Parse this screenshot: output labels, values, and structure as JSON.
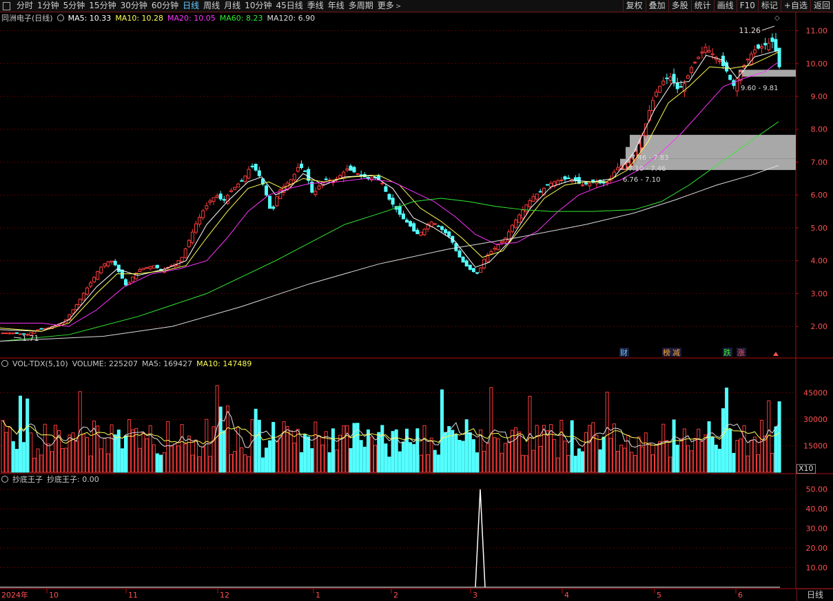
{
  "toolbar": {
    "periods": [
      "分时",
      "1分钟",
      "5分钟",
      "15分钟",
      "30分钟",
      "60分钟",
      "日线",
      "周线",
      "月线",
      "10分钟",
      "45日线",
      "季线",
      "年线",
      "多周期"
    ],
    "active_period": "日线",
    "more": "更多",
    "right_buttons": [
      "复权",
      "叠加",
      "多股",
      "统计",
      "画线",
      "F10",
      "标记",
      "+自选",
      "返回"
    ]
  },
  "main_panel": {
    "title": "同洲电子(日线)",
    "ma_labels": [
      {
        "text": "MA5: 10.33",
        "color": "#ffffff"
      },
      {
        "text": "MA10: 10.28",
        "color": "#ffff54"
      },
      {
        "text": "MA20: 10.05",
        "color": "#ff33ff"
      },
      {
        "text": "MA60: 8.23",
        "color": "#33ee33"
      },
      {
        "text": "MA120: 6.90",
        "color": "#dddddd"
      }
    ],
    "high_label": "11.26",
    "low_label": "1.71",
    "gap_labels": [
      "9.60 - 9.81",
      "7.46 - 7.83",
      "7.10 - 7.46",
      "6.76 - 7.10"
    ],
    "event_markers": [
      "财",
      "榜",
      "减",
      "跌",
      "涨"
    ]
  },
  "volume_panel": {
    "title": "VOL-TDX(5,10)",
    "volume": "VOLUME: 225207",
    "ma5": "MA5: 169427",
    "ma10": "MA10: 147489",
    "scale": "X10"
  },
  "indicator_panel": {
    "title": "抄底王子",
    "value_label": "抄底王子: 0.00"
  },
  "x_axis": {
    "year_label": "2024年",
    "month_labels": [
      "10",
      "11",
      "12",
      "1",
      "2",
      "3",
      "4",
      "5",
      "6"
    ],
    "period_label": "日线"
  },
  "chart_data": [
    {
      "type": "candlestick",
      "ylim": [
        1.3,
        11.9
      ],
      "y_ticks": [
        2.0,
        3.0,
        4.0,
        5.0,
        6.0,
        7.0,
        8.0,
        9.0,
        10.0,
        11.0
      ],
      "close_path": [
        [
          0,
          1.8
        ],
        [
          20,
          1.8
        ],
        [
          40,
          1.75
        ],
        [
          55,
          1.9
        ],
        [
          70,
          1.95
        ],
        [
          85,
          2.05
        ],
        [
          95,
          2.15
        ],
        [
          105,
          2.45
        ],
        [
          115,
          2.75
        ],
        [
          125,
          3.1
        ],
        [
          135,
          3.4
        ],
        [
          145,
          3.75
        ],
        [
          155,
          3.95
        ],
        [
          165,
          4.0
        ],
        [
          175,
          3.6
        ],
        [
          185,
          3.2
        ],
        [
          195,
          3.55
        ],
        [
          205,
          3.75
        ],
        [
          215,
          3.8
        ],
        [
          225,
          3.85
        ],
        [
          235,
          3.7
        ],
        [
          245,
          3.8
        ],
        [
          255,
          3.9
        ],
        [
          265,
          4.1
        ],
        [
          275,
          4.6
        ],
        [
          285,
          5.1
        ],
        [
          295,
          5.5
        ],
        [
          305,
          5.8
        ],
        [
          315,
          6.0
        ],
        [
          325,
          5.8
        ],
        [
          335,
          6.1
        ],
        [
          345,
          6.3
        ],
        [
          355,
          6.5
        ],
        [
          365,
          6.9
        ],
        [
          375,
          6.7
        ],
        [
          385,
          6.2
        ],
        [
          395,
          5.4
        ],
        [
          405,
          6.1
        ],
        [
          415,
          6.3
        ],
        [
          425,
          6.5
        ],
        [
          435,
          6.9
        ],
        [
          445,
          6.7
        ],
        [
          455,
          6.0
        ],
        [
          465,
          6.3
        ],
        [
          475,
          6.5
        ],
        [
          485,
          6.4
        ],
        [
          495,
          6.6
        ],
        [
          505,
          6.8
        ],
        [
          515,
          6.7
        ],
        [
          525,
          6.6
        ],
        [
          535,
          6.5
        ],
        [
          545,
          6.55
        ],
        [
          555,
          6.4
        ],
        [
          565,
          5.9
        ],
        [
          575,
          5.6
        ],
        [
          585,
          5.3
        ],
        [
          595,
          5.1
        ],
        [
          605,
          4.8
        ],
        [
          615,
          4.9
        ],
        [
          625,
          5.2
        ],
        [
          635,
          5.1
        ],
        [
          645,
          4.9
        ],
        [
          655,
          4.7
        ],
        [
          665,
          4.2
        ],
        [
          675,
          3.9
        ],
        [
          685,
          3.7
        ],
        [
          695,
          3.6
        ],
        [
          705,
          4.1
        ],
        [
          715,
          4.3
        ],
        [
          725,
          4.5
        ],
        [
          735,
          4.7
        ],
        [
          745,
          5.1
        ],
        [
          755,
          5.4
        ],
        [
          765,
          5.7
        ],
        [
          775,
          5.95
        ],
        [
          785,
          6.1
        ],
        [
          795,
          6.3
        ],
        [
          805,
          6.4
        ],
        [
          815,
          6.45
        ],
        [
          825,
          6.5
        ],
        [
          835,
          6.45
        ],
        [
          845,
          6.3
        ],
        [
          855,
          6.35
        ],
        [
          865,
          6.4
        ],
        [
          875,
          6.35
        ],
        [
          885,
          6.4
        ],
        [
          895,
          6.8
        ],
        [
          905,
          6.9
        ],
        [
          915,
          7.0
        ],
        [
          925,
          7.4
        ],
        [
          935,
          7.9
        ],
        [
          945,
          8.7
        ],
        [
          955,
          9.2
        ],
        [
          965,
          9.5
        ],
        [
          975,
          9.6
        ],
        [
          985,
          9.2
        ],
        [
          995,
          9.4
        ],
        [
          1005,
          9.9
        ],
        [
          1015,
          10.2
        ],
        [
          1025,
          10.5
        ],
        [
          1035,
          10.3
        ],
        [
          1045,
          10.1
        ],
        [
          1055,
          9.8
        ],
        [
          1065,
          9.3
        ],
        [
          1075,
          9.7
        ],
        [
          1085,
          10.1
        ],
        [
          1095,
          10.4
        ],
        [
          1105,
          10.5
        ],
        [
          1115,
          10.6
        ],
        [
          1125,
          10.7
        ],
        [
          1130,
          9.9
        ]
      ],
      "ma_series": [
        {
          "name": "MA5",
          "color": "#ffffff",
          "points": [
            [
              0,
              1.9
            ],
            [
              60,
              1.85
            ],
            [
              100,
              2.2
            ],
            [
              140,
              3.2
            ],
            [
              170,
              3.75
            ],
            [
              200,
              3.55
            ],
            [
              240,
              3.75
            ],
            [
              270,
              4.0
            ],
            [
              300,
              5.1
            ],
            [
              330,
              5.8
            ],
            [
              360,
              6.4
            ],
            [
              380,
              6.55
            ],
            [
              400,
              6.0
            ],
            [
              420,
              6.2
            ],
            [
              440,
              6.65
            ],
            [
              470,
              6.3
            ],
            [
              500,
              6.55
            ],
            [
              540,
              6.6
            ],
            [
              570,
              6.2
            ],
            [
              600,
              5.3
            ],
            [
              630,
              5.0
            ],
            [
              660,
              4.6
            ],
            [
              690,
              3.8
            ],
            [
              710,
              3.95
            ],
            [
              740,
              4.6
            ],
            [
              770,
              5.6
            ],
            [
              800,
              6.25
            ],
            [
              830,
              6.45
            ],
            [
              860,
              6.4
            ],
            [
              890,
              6.5
            ],
            [
              920,
              7.3
            ],
            [
              950,
              8.6
            ],
            [
              975,
              9.4
            ],
            [
              1000,
              9.45
            ],
            [
              1025,
              10.25
            ],
            [
              1050,
              10.1
            ],
            [
              1070,
              9.55
            ],
            [
              1095,
              10.2
            ],
            [
              1130,
              10.4
            ]
          ]
        },
        {
          "name": "MA10",
          "color": "#ffff54",
          "points": [
            [
              0,
              1.95
            ],
            [
              60,
              1.85
            ],
            [
              100,
              2.1
            ],
            [
              140,
              3.0
            ],
            [
              170,
              3.6
            ],
            [
              200,
              3.6
            ],
            [
              240,
              3.7
            ],
            [
              270,
              3.85
            ],
            [
              300,
              4.7
            ],
            [
              330,
              5.5
            ],
            [
              360,
              6.2
            ],
            [
              390,
              6.4
            ],
            [
              410,
              6.2
            ],
            [
              440,
              6.5
            ],
            [
              470,
              6.4
            ],
            [
              510,
              6.55
            ],
            [
              550,
              6.6
            ],
            [
              580,
              6.3
            ],
            [
              610,
              5.6
            ],
            [
              640,
              5.2
            ],
            [
              670,
              4.7
            ],
            [
              700,
              4.1
            ],
            [
              730,
              4.3
            ],
            [
              760,
              5.1
            ],
            [
              790,
              5.9
            ],
            [
              820,
              6.3
            ],
            [
              850,
              6.4
            ],
            [
              880,
              6.4
            ],
            [
              910,
              6.75
            ],
            [
              940,
              7.6
            ],
            [
              970,
              8.8
            ],
            [
              1000,
              9.3
            ],
            [
              1030,
              9.9
            ],
            [
              1060,
              9.85
            ],
            [
              1090,
              9.95
            ],
            [
              1130,
              10.35
            ]
          ]
        },
        {
          "name": "MA20",
          "color": "#ff33ff",
          "points": [
            [
              0,
              2.1
            ],
            [
              60,
              2.1
            ],
            [
              100,
              2.0
            ],
            [
              140,
              2.5
            ],
            [
              180,
              3.2
            ],
            [
              220,
              3.6
            ],
            [
              260,
              3.75
            ],
            [
              300,
              4.0
            ],
            [
              330,
              4.7
            ],
            [
              360,
              5.5
            ],
            [
              390,
              6.0
            ],
            [
              420,
              6.2
            ],
            [
              450,
              6.35
            ],
            [
              490,
              6.4
            ],
            [
              530,
              6.5
            ],
            [
              570,
              6.4
            ],
            [
              600,
              6.1
            ],
            [
              630,
              5.8
            ],
            [
              660,
              5.35
            ],
            [
              690,
              4.8
            ],
            [
              720,
              4.5
            ],
            [
              750,
              4.55
            ],
            [
              780,
              4.9
            ],
            [
              810,
              5.5
            ],
            [
              840,
              6.0
            ],
            [
              870,
              6.25
            ],
            [
              900,
              6.45
            ],
            [
              930,
              6.8
            ],
            [
              960,
              7.3
            ],
            [
              990,
              7.9
            ],
            [
              1020,
              8.6
            ],
            [
              1050,
              9.3
            ],
            [
              1080,
              9.55
            ],
            [
              1110,
              9.75
            ],
            [
              1130,
              10.05
            ]
          ]
        },
        {
          "name": "MA60",
          "color": "#33ee33",
          "points": [
            [
              0,
              1.55
            ],
            [
              100,
              1.75
            ],
            [
              200,
              2.3
            ],
            [
              300,
              3.0
            ],
            [
              400,
              4.0
            ],
            [
              500,
              5.1
            ],
            [
              560,
              5.5
            ],
            [
              600,
              5.8
            ],
            [
              640,
              5.9
            ],
            [
              680,
              5.8
            ],
            [
              720,
              5.65
            ],
            [
              760,
              5.55
            ],
            [
              800,
              5.5
            ],
            [
              860,
              5.5
            ],
            [
              920,
              5.55
            ],
            [
              960,
              5.8
            ],
            [
              1000,
              6.3
            ],
            [
              1040,
              6.9
            ],
            [
              1080,
              7.5
            ],
            [
              1130,
              8.23
            ]
          ]
        },
        {
          "name": "MA120",
          "color": "#dddddd",
          "points": [
            [
              0,
              1.55
            ],
            [
              150,
              1.7
            ],
            [
              250,
              2.0
            ],
            [
              350,
              2.6
            ],
            [
              450,
              3.3
            ],
            [
              550,
              3.9
            ],
            [
              650,
              4.35
            ],
            [
              750,
              4.7
            ],
            [
              850,
              5.1
            ],
            [
              920,
              5.45
            ],
            [
              980,
              5.85
            ],
            [
              1040,
              6.3
            ],
            [
              1090,
              6.6
            ],
            [
              1130,
              6.9
            ]
          ]
        }
      ]
    },
    {
      "type": "bar",
      "name": "VOLUME",
      "ylim": [
        0,
        60000
      ],
      "y_ticks": [
        15000,
        30000,
        45000
      ],
      "values_seed": "volume_series"
    },
    {
      "type": "line",
      "name": "抄底王子",
      "ylim": [
        0,
        55
      ],
      "y_ticks": [
        10.0,
        20.0,
        30.0,
        40.0,
        50.0
      ],
      "x": [
        690,
        697,
        704
      ],
      "y": [
        0,
        50,
        0
      ]
    }
  ]
}
